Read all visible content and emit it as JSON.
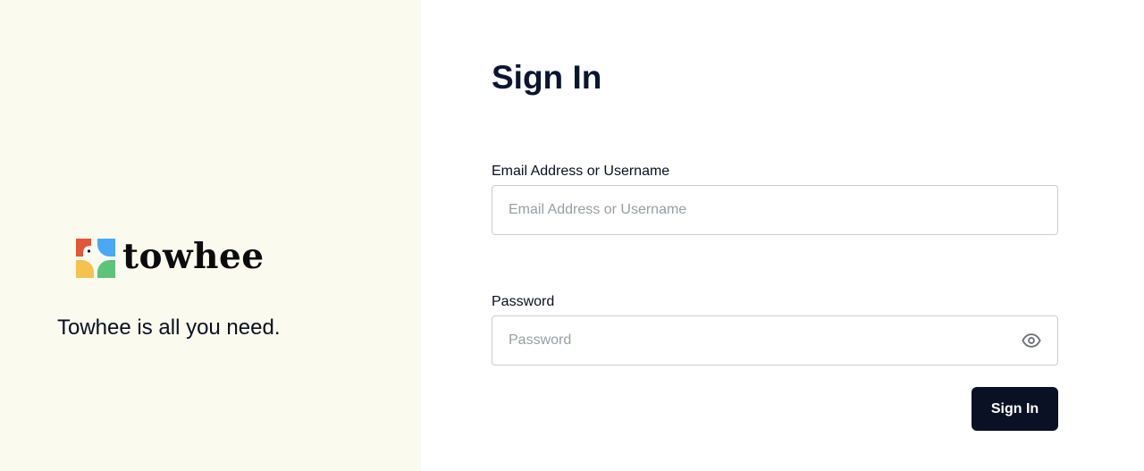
{
  "brand": {
    "name": "towhee",
    "tagline": "Towhee is all you need.",
    "logo_icon": "towhee-logo-icon",
    "logo_colors": {
      "top_left": "#e2563a",
      "top_right": "#4aa8f5",
      "bottom_left": "#f5c24e",
      "bottom_right": "#5cc47a"
    }
  },
  "form": {
    "title": "Sign In",
    "email": {
      "label": "Email Address or Username",
      "placeholder": "Email Address or Username",
      "value": ""
    },
    "password": {
      "label": "Password",
      "placeholder": "Password",
      "value": "",
      "toggle_icon": "eye-icon"
    },
    "submit_label": "Sign In"
  },
  "colors": {
    "left_background": "#fafaef",
    "primary_button": "#0a1124",
    "input_border": "#c9ccd2"
  }
}
